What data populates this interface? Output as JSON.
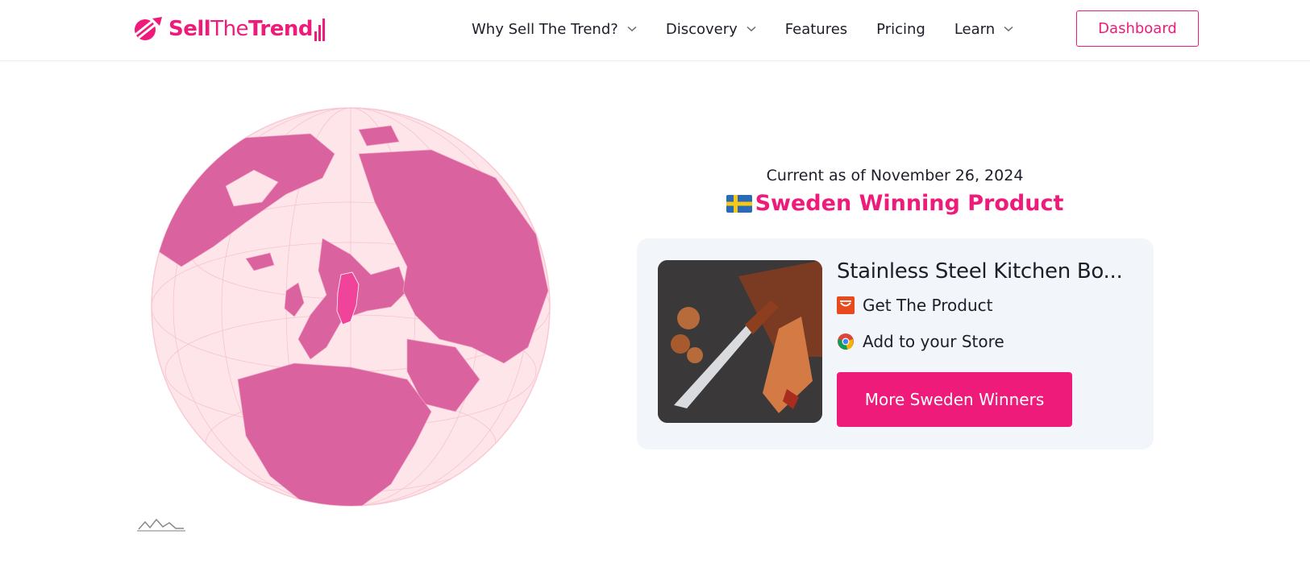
{
  "brand": {
    "part1": "Sell",
    "part2": "The",
    "part3": "Trend",
    "accent": "#ee1b7a"
  },
  "nav": {
    "items": [
      {
        "label": "Why Sell The Trend?",
        "has_dropdown": true
      },
      {
        "label": "Discovery",
        "has_dropdown": true
      },
      {
        "label": "Features",
        "has_dropdown": false
      },
      {
        "label": "Pricing",
        "has_dropdown": false
      },
      {
        "label": "Learn",
        "has_dropdown": true
      }
    ],
    "dashboard_label": "Dashboard"
  },
  "hero": {
    "current_as_of": "Current as of November 26, 2024",
    "winner_title": "Sweden Winning Product",
    "flag_icon": "sweden-flag-icon"
  },
  "product": {
    "name": "Stainless Steel Kitchen Bo...",
    "get_product_label": "Get The Product",
    "get_product_icon": "aliexpress-icon",
    "add_store_label": "Add to your Store",
    "add_store_icon": "chrome-icon",
    "more_button_label": "More Sweden Winners"
  },
  "colors": {
    "globe_land": "#d9629f",
    "globe_ocean": "#fde5ea",
    "highlight_country": "#f0439a",
    "card_bg": "#f2f5f9"
  }
}
